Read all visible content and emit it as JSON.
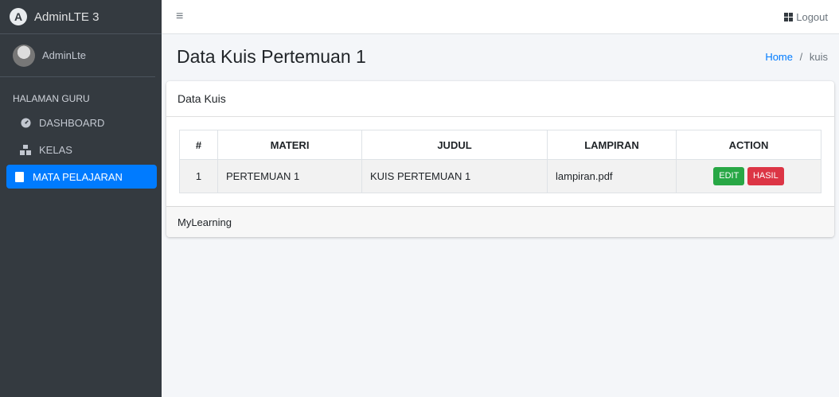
{
  "brand": {
    "title": "AdminLTE 3",
    "logo_letter": "A"
  },
  "user": {
    "name": "AdminLte"
  },
  "sidebar": {
    "header": "HALAMAN GURU",
    "items": [
      {
        "label": "DASHBOARD",
        "icon": "tachometer-icon",
        "active": false
      },
      {
        "label": "KELAS",
        "icon": "cubes-icon",
        "active": false
      },
      {
        "label": "MATA PELAJARAN",
        "icon": "book-icon",
        "active": true
      }
    ]
  },
  "topbar": {
    "menu_icon": "≡",
    "logout_label": "Logout"
  },
  "page": {
    "title": "Data Kuis Pertemuan 1",
    "breadcrumb": {
      "home": "Home",
      "separator": "/",
      "current": "kuis"
    }
  },
  "card": {
    "title": "Data Kuis",
    "footer": "MyLearning",
    "table": {
      "headers": [
        "#",
        "MATERI",
        "JUDUL",
        "LAMPIRAN",
        "ACTION"
      ],
      "rows": [
        {
          "no": "1",
          "materi": "PERTEMUAN 1",
          "judul": "KUIS PERTEMUAN 1",
          "lampiran": "lampiran.pdf",
          "edit_label": "EDIT",
          "hasil_label": "HASIL"
        }
      ]
    }
  },
  "colors": {
    "sidebar_bg": "#343a40",
    "accent": "#007bff",
    "success": "#28a745",
    "danger": "#dc3545"
  }
}
